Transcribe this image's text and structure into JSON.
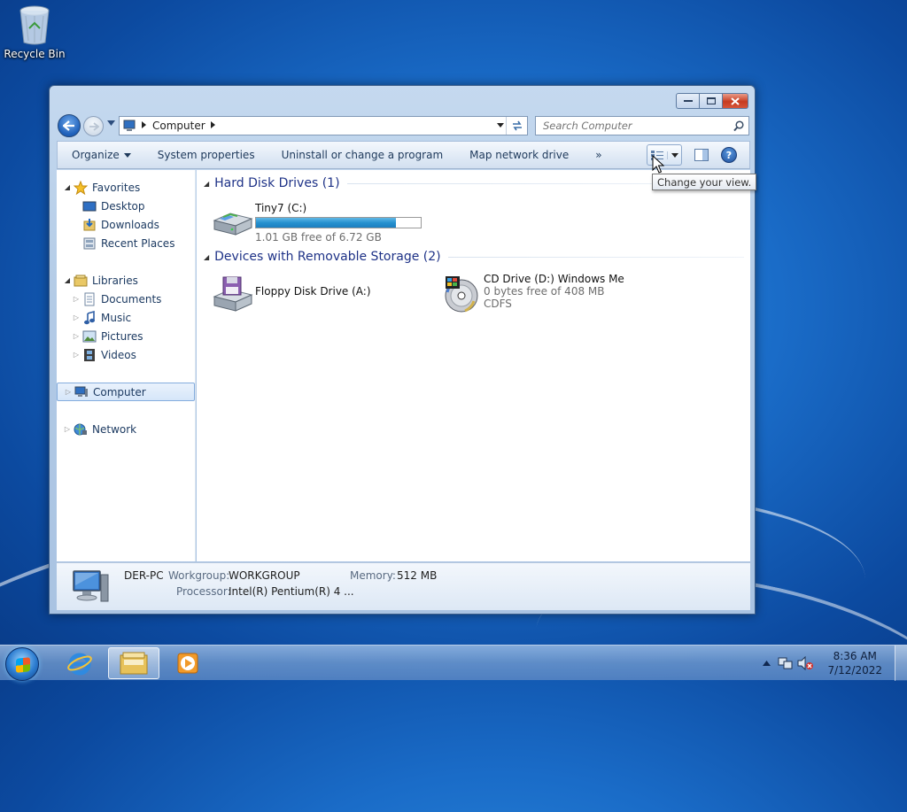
{
  "desktop": {
    "recycle_bin_label": "Recycle Bin"
  },
  "window": {
    "address": {
      "location": "Computer"
    },
    "search": {
      "placeholder": "Search Computer"
    },
    "toolbar": {
      "organize": "Organize",
      "system_properties": "System properties",
      "uninstall": "Uninstall or change a program",
      "map_drive": "Map network drive",
      "more": "»"
    },
    "tooltip": "Change your view.",
    "nav": {
      "favorites": "Favorites",
      "desktop": "Desktop",
      "downloads": "Downloads",
      "recent_places": "Recent Places",
      "libraries": "Libraries",
      "documents": "Documents",
      "music": "Music",
      "pictures": "Pictures",
      "videos": "Videos",
      "computer": "Computer",
      "network": "Network"
    },
    "groups": {
      "hard_disk": "Hard Disk Drives (1)",
      "removable": "Devices with Removable Storage (2)"
    },
    "drives": {
      "c": {
        "name": "Tiny7 (C:)",
        "free": "1.01 GB free of 6.72 GB",
        "used_fraction": 0.85
      },
      "a": {
        "name": "Floppy Disk Drive (A:)"
      },
      "d": {
        "name": "CD Drive (D:) Windows Me",
        "free": "0 bytes free of 408 MB",
        "fs": "CDFS"
      }
    },
    "details": {
      "pc_name": "DER-PC",
      "workgroup_label": "Workgroup:",
      "workgroup": "WORKGROUP",
      "memory_label": "Memory:",
      "memory": "512 MB",
      "processor_label": "Processor:",
      "processor": "Intel(R) Pentium(R) 4   ..."
    }
  },
  "taskbar": {
    "time": "8:36 AM",
    "date": "7/12/2022"
  },
  "colors": {
    "group_header": "#1e3287",
    "capacity_fill": "#2691cf",
    "selection": "#d5e6f9"
  }
}
